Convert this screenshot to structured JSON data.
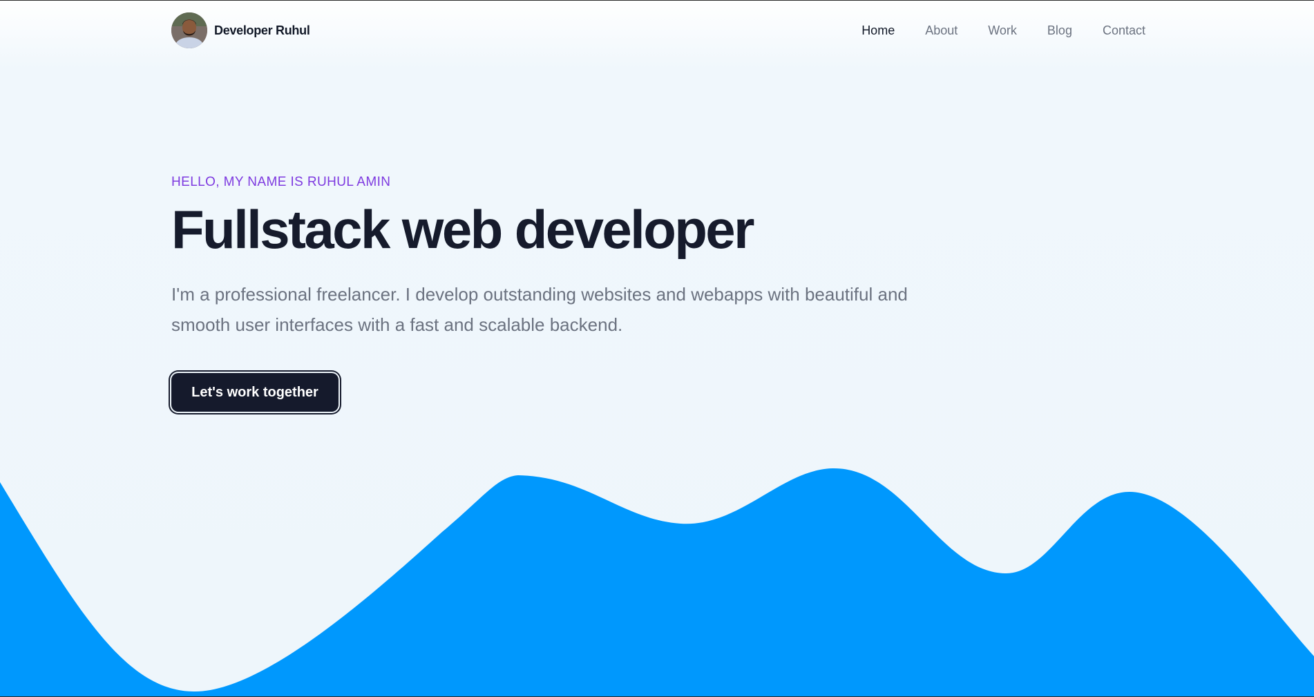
{
  "brand": {
    "name": "Developer Ruhul"
  },
  "nav": {
    "items": [
      {
        "label": "Home",
        "active": true
      },
      {
        "label": "About",
        "active": false
      },
      {
        "label": "Work",
        "active": false
      },
      {
        "label": "Blog",
        "active": false
      },
      {
        "label": "Contact",
        "active": false
      }
    ]
  },
  "hero": {
    "eyebrow": "HELLO, MY NAME IS RUHUL AMIN",
    "headline": "Fullstack web developer",
    "description": "I'm a professional freelancer. I develop outstanding websites and webapps with beautiful and smooth user interfaces with a fast and scalable backend.",
    "cta_label": "Let's work together"
  },
  "colors": {
    "accent": "#7e3ae0",
    "wave": "#0098fd",
    "button": "#151a2c",
    "background": "#eef6fb"
  },
  "icons": {
    "avatar": "profile-photo"
  }
}
